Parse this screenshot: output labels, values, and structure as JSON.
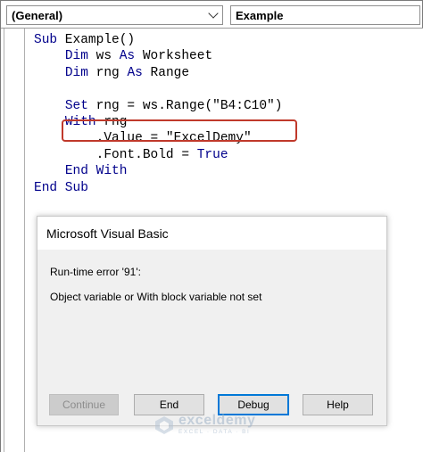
{
  "toolbar": {
    "object_combo": "(General)",
    "procedure_combo": "Example"
  },
  "code_lines": [
    {
      "segments": [
        {
          "t": "Sub",
          "kw": true
        },
        {
          "t": " Example()",
          "kw": false
        }
      ]
    },
    {
      "segments": [
        {
          "t": "    ",
          "kw": false
        },
        {
          "t": "Dim",
          "kw": true
        },
        {
          "t": " ws ",
          "kw": false
        },
        {
          "t": "As",
          "kw": true
        },
        {
          "t": " Worksheet",
          "kw": false
        }
      ]
    },
    {
      "segments": [
        {
          "t": "    ",
          "kw": false
        },
        {
          "t": "Dim",
          "kw": true
        },
        {
          "t": " rng ",
          "kw": false
        },
        {
          "t": "As",
          "kw": true
        },
        {
          "t": " Range",
          "kw": false
        }
      ]
    },
    {
      "segments": []
    },
    {
      "segments": [
        {
          "t": "    ",
          "kw": false
        },
        {
          "t": "Set",
          "kw": true
        },
        {
          "t": " rng = ws.Range(\"B4:C10\")",
          "kw": false
        }
      ]
    },
    {
      "segments": [
        {
          "t": "    ",
          "kw": false
        },
        {
          "t": "With",
          "kw": true
        },
        {
          "t": " rng",
          "kw": false
        }
      ]
    },
    {
      "segments": [
        {
          "t": "        .Value = \"ExcelDemy\"",
          "kw": false
        }
      ]
    },
    {
      "segments": [
        {
          "t": "        .Font.Bold = ",
          "kw": false
        },
        {
          "t": "True",
          "kw": true
        }
      ]
    },
    {
      "segments": [
        {
          "t": "    ",
          "kw": false
        },
        {
          "t": "End With",
          "kw": true
        }
      ]
    },
    {
      "segments": [
        {
          "t": "End Sub",
          "kw": true
        }
      ]
    }
  ],
  "dialog": {
    "title": "Microsoft Visual Basic",
    "error": "Run-time error '91':",
    "message": "Object variable or With block variable not set",
    "buttons": {
      "continue": "Continue",
      "end": "End",
      "debug": "Debug",
      "help": "Help"
    }
  },
  "watermark": {
    "name": "exceldemy",
    "tagline": "EXCEL · DATA · BI"
  },
  "colors": {
    "keyword": "#00008b",
    "highlight": "#c0392b",
    "focus": "#0078d7"
  }
}
